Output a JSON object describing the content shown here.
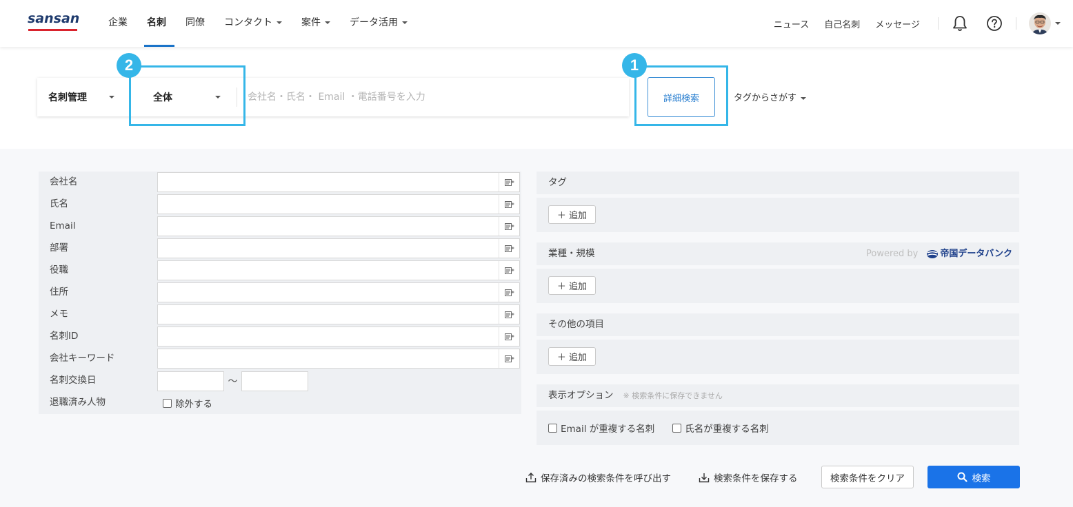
{
  "brand": {
    "logo_text": "sansan"
  },
  "nav": {
    "items": [
      {
        "label": "企業",
        "has_caret": false,
        "active": false
      },
      {
        "label": "名刺",
        "has_caret": false,
        "active": true
      },
      {
        "label": "同僚",
        "has_caret": false,
        "active": false
      },
      {
        "label": "コンタクト",
        "has_caret": true,
        "active": false
      },
      {
        "label": "案件",
        "has_caret": true,
        "active": false
      },
      {
        "label": "データ活用",
        "has_caret": true,
        "active": false
      }
    ],
    "right_links": [
      "ニュース",
      "自己名刺",
      "メッセージ"
    ],
    "icons": [
      "bell-icon",
      "help-icon",
      "avatar"
    ]
  },
  "search": {
    "scope_select": "名刺管理",
    "range_select": "全体",
    "placeholder": "会社名・氏名・ Email ・電話番号を入力",
    "advanced_label": "詳細検索",
    "tag_search_label": "タグからさがす",
    "callouts": [
      "1",
      "2"
    ]
  },
  "form": {
    "fields": [
      "会社名",
      "氏名",
      "Email",
      "部署",
      "役職",
      "住所",
      "メモ",
      "名刺ID",
      "会社キーワード"
    ],
    "date_label": "名刺交換日",
    "date_separator": "〜",
    "retired_label": "退職済み人物",
    "exclude_label": "除外する"
  },
  "right": {
    "tag_section": "タグ",
    "industry_section": "業種・規模",
    "powered_by": "Powered by",
    "powered_brand": "帝国データバンク",
    "other_section": "その他の項目",
    "add_label": "＋ 追加",
    "display_options": "表示オプション",
    "display_note": "※ 検索条件に保存できません",
    "dup_email": "Email が重複する名刺",
    "dup_name": "氏名が重複する名刺"
  },
  "actions": {
    "load_saved": "保存済みの検索条件を呼び出す",
    "save": "検索条件を保存する",
    "clear": "検索条件をクリア",
    "search": "検索"
  },
  "colors": {
    "accent": "#1a73e8",
    "highlight": "#35b6e8",
    "logo_red": "#d9232d",
    "logo_navy": "#1e3a6d"
  }
}
